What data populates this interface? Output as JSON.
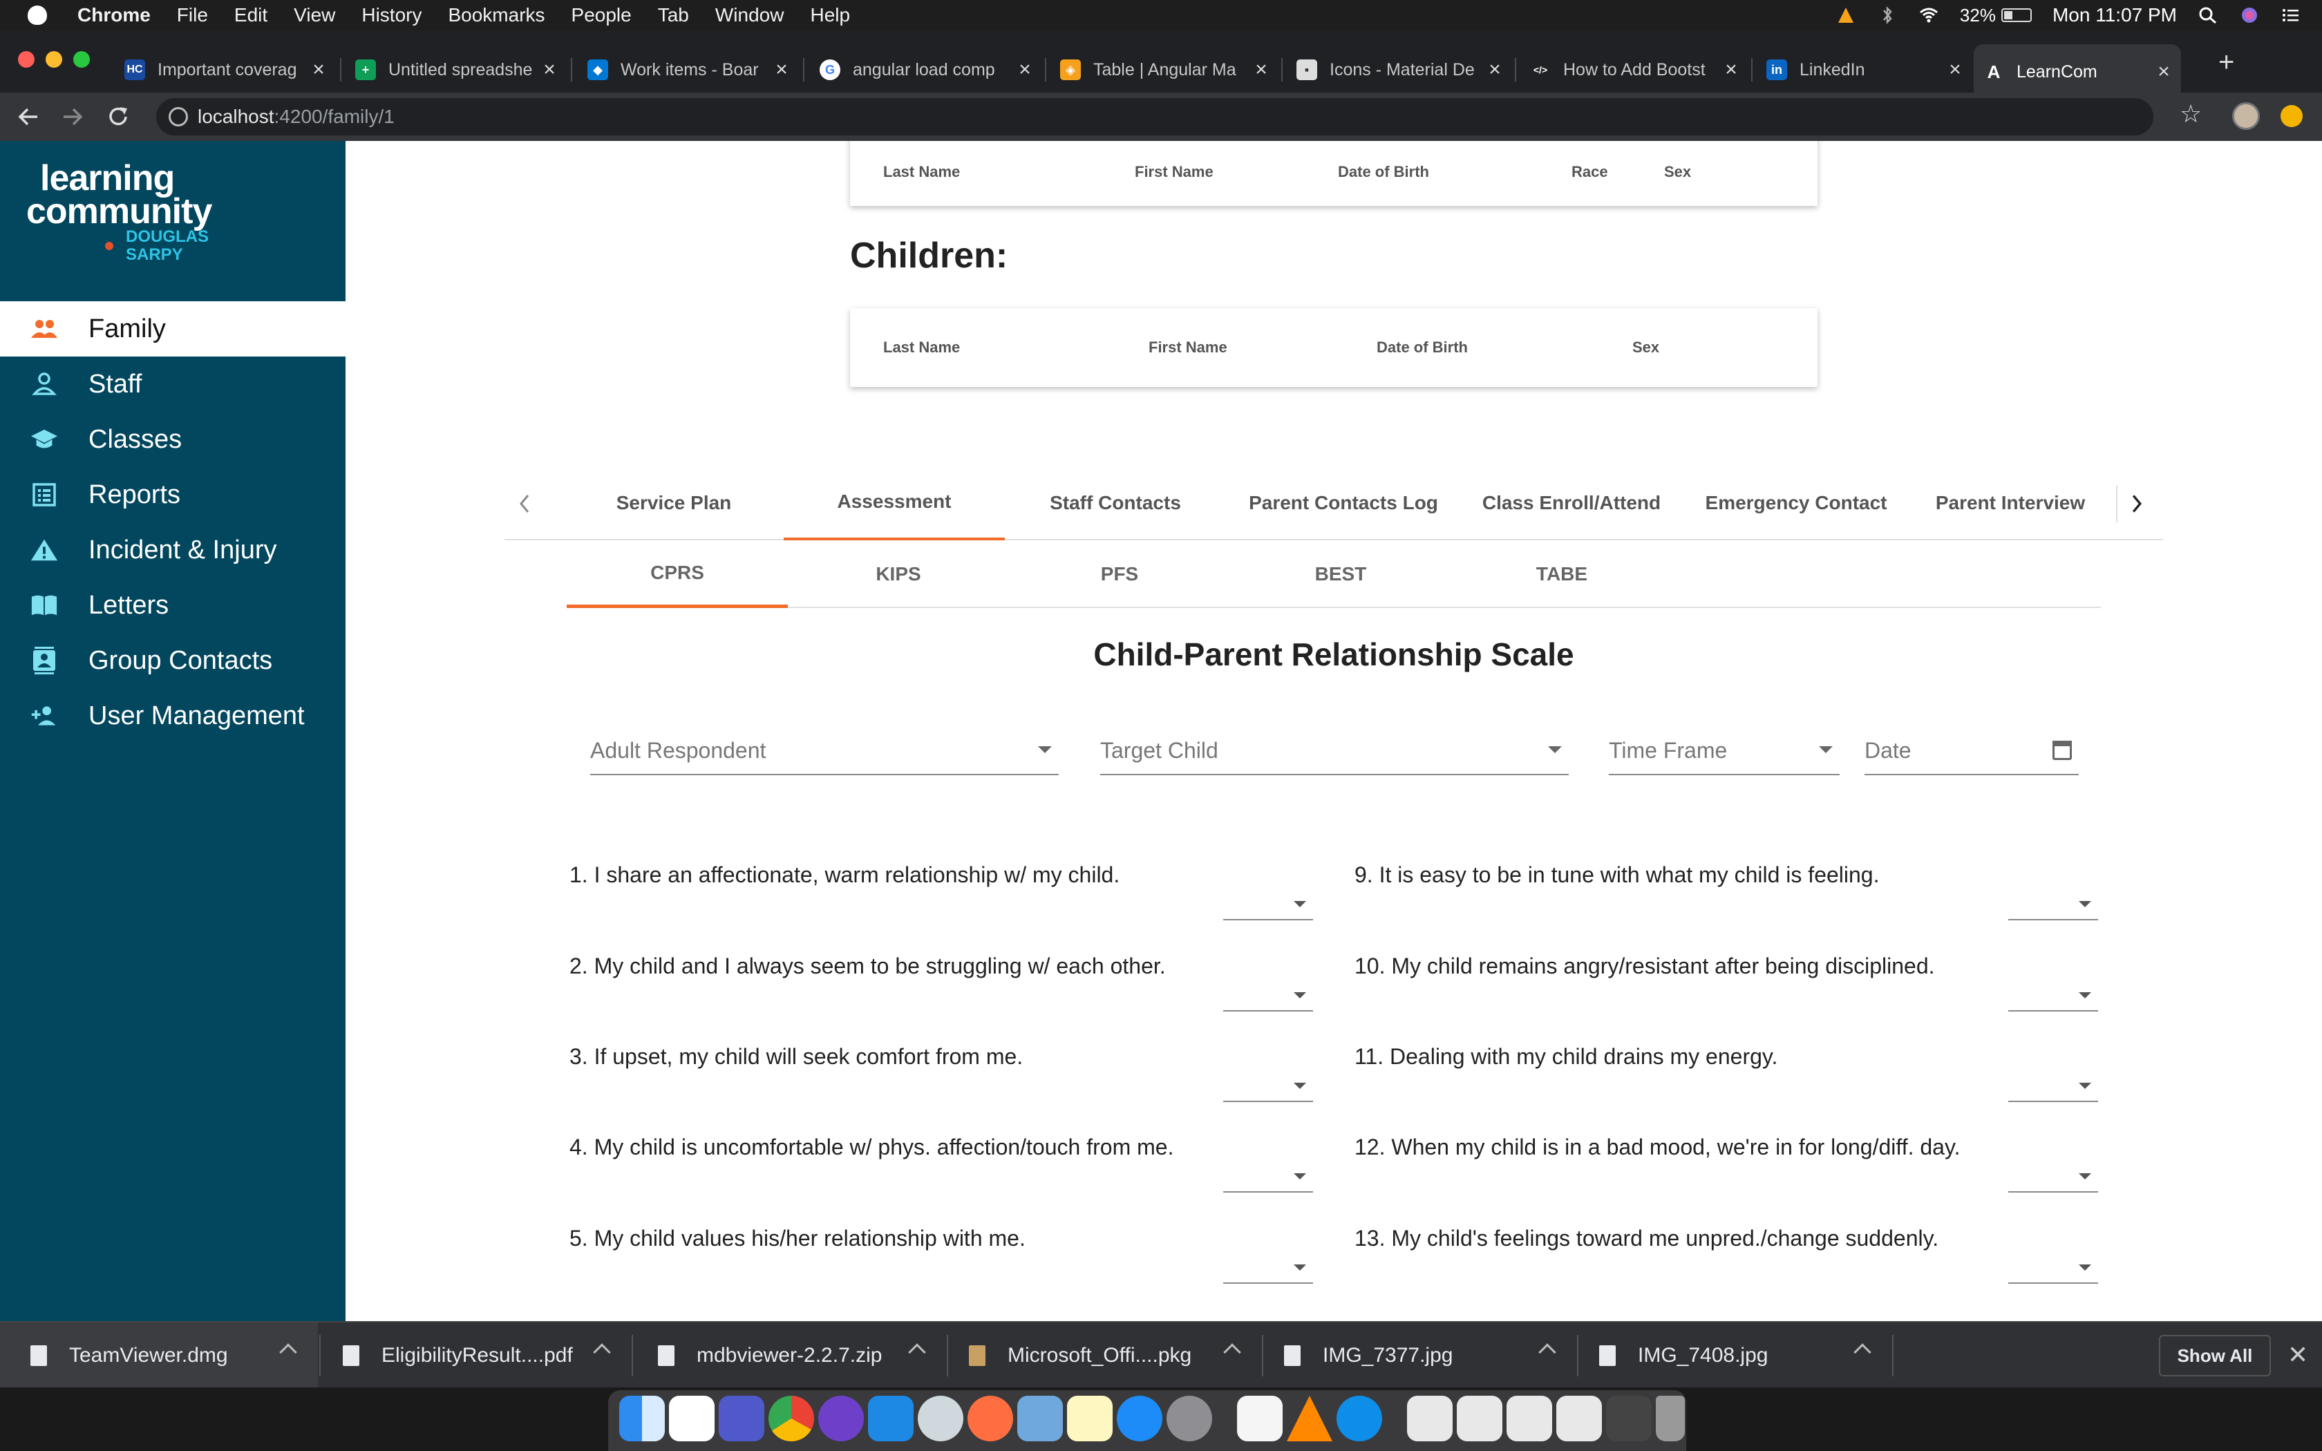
{
  "menubar": {
    "app": "Chrome",
    "items": [
      "File",
      "Edit",
      "View",
      "History",
      "Bookmarks",
      "People",
      "Tab",
      "Window",
      "Help"
    ],
    "battery": "32%",
    "clock": "Mon 11:07 PM"
  },
  "browser": {
    "tabs": [
      {
        "title": "Important coverag",
        "fav": "HC",
        "color": "#1a4aa0"
      },
      {
        "title": "Untitled spreadshe",
        "fav": "+",
        "color": "#0f9d58"
      },
      {
        "title": "Work items - Boar",
        "fav": "◆",
        "color": "#0078d4"
      },
      {
        "title": "angular load comp",
        "fav": "G",
        "color": "#ffffff"
      },
      {
        "title": "Table | Angular Ma",
        "fav": "◈",
        "color": "#f6a11e"
      },
      {
        "title": "Icons - Material De",
        "fav": "▪",
        "color": "#dddddd"
      },
      {
        "title": "How to Add Bootst",
        "fav": "</>",
        "color": "#202124"
      },
      {
        "title": "LinkedIn",
        "fav": "in",
        "color": "#0a66c2"
      },
      {
        "title": "LearnCom",
        "fav": "A",
        "color": "#35363a"
      }
    ],
    "url_host": "localhost",
    "url_path": ":4200/family/1"
  },
  "sidebar": {
    "logo": {
      "line1": "learning",
      "line2": "community",
      "line3": "DOUGLAS",
      "line4": "SARPY"
    },
    "items": [
      {
        "label": "Family",
        "icon": "people-icon",
        "active": true
      },
      {
        "label": "Staff",
        "icon": "person-icon"
      },
      {
        "label": "Classes",
        "icon": "school-icon"
      },
      {
        "label": "Reports",
        "icon": "list-icon"
      },
      {
        "label": "Incident & Injury",
        "icon": "warning-icon"
      },
      {
        "label": "Letters",
        "icon": "book-icon"
      },
      {
        "label": "Group Contacts",
        "icon": "contacts-icon"
      },
      {
        "label": "User Management",
        "icon": "person-add-icon"
      }
    ]
  },
  "parents_table": {
    "columns": [
      "Last Name",
      "First Name",
      "Date of Birth",
      "Race",
      "Sex"
    ]
  },
  "children": {
    "heading": "Children:",
    "columns": [
      "Last Name",
      "First Name",
      "Date of Birth",
      "Sex"
    ]
  },
  "main_tabs": [
    "Service Plan",
    "Assessment",
    "Staff Contacts",
    "Parent Contacts Log",
    "Class Enroll/Attend",
    "Emergency Contact",
    "Parent Interview"
  ],
  "main_tabs_active": "Assessment",
  "sub_tabs": [
    "CPRS",
    "KIPS",
    "PFS",
    "BEST",
    "TABE"
  ],
  "sub_tabs_active": "CPRS",
  "cprs": {
    "title": "Child-Parent Relationship Scale",
    "fields": {
      "adult": "Adult Respondent",
      "child": "Target Child",
      "timeframe": "Time Frame",
      "date": "Date"
    },
    "left_questions": [
      "1. I share an affectionate, warm relationship w/ my child.",
      "2. My child and I always seem to be struggling w/ each other.",
      "3. If upset, my child will seek comfort from me.",
      "4. My child is uncomfortable w/ phys. affection/touch from me.",
      "5. My child values his/her relationship with me."
    ],
    "right_questions": [
      "9. It is easy to be in tune with what my child is feeling.",
      "10. My child remains angry/resistant after being disciplined.",
      "11. Dealing with my child drains my energy.",
      "12. When my child is in a bad mood, we're in for long/diff. day.",
      "13. My child's feelings toward me unpred./change suddenly."
    ]
  },
  "downloads": {
    "items": [
      "TeamViewer.dmg",
      "EligibilityResult....pdf",
      "mdbviewer-2.2.7.zip",
      "Microsoft_Offi....pkg",
      "IMG_7377.jpg",
      "IMG_7408.jpg"
    ],
    "show_all": "Show All"
  },
  "colors": {
    "sidebar": "#02475e",
    "accent": "#f26b2a",
    "logo_accent": "#2fc3e5"
  }
}
